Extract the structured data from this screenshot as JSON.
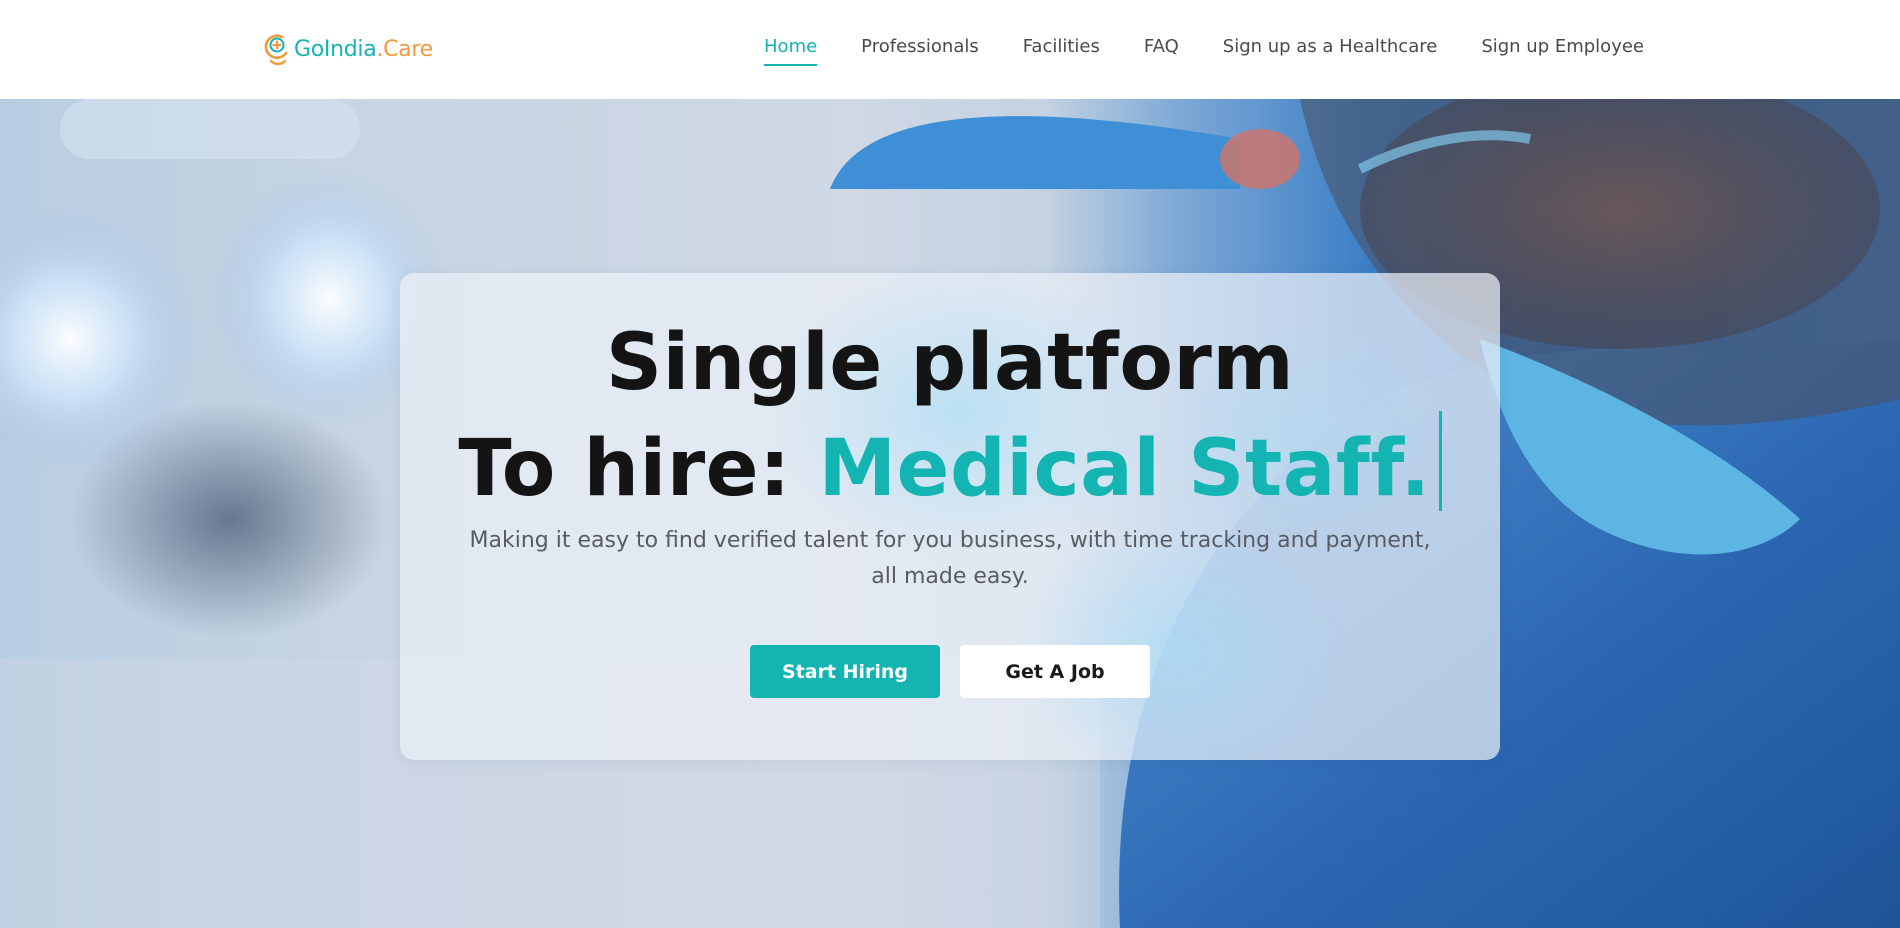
{
  "brand": {
    "name_part1": "GoIndia",
    "name_part2": ".Care",
    "logo_icon": "medical-cross-badge-icon",
    "colors": {
      "primary": "#13b4b1",
      "accent": "#f39a3c"
    }
  },
  "nav": {
    "items": [
      {
        "label": "Home",
        "active": true
      },
      {
        "label": "Professionals",
        "active": false
      },
      {
        "label": "Facilities",
        "active": false
      },
      {
        "label": "FAQ",
        "active": false
      },
      {
        "label": "Sign up as a Healthcare",
        "active": false
      },
      {
        "label": "Sign up Employee",
        "active": false
      }
    ]
  },
  "hero": {
    "title_line1": "Single platform",
    "title_line2_prefix": "To hire: ",
    "title_line2_highlight": "Medical Staff.",
    "subtitle_line1": "Making it easy to find verified talent for you business, with time tracking and payment,",
    "subtitle_line2": "all made easy.",
    "primary_button": "Start Hiring",
    "secondary_button": "Get A Job"
  }
}
